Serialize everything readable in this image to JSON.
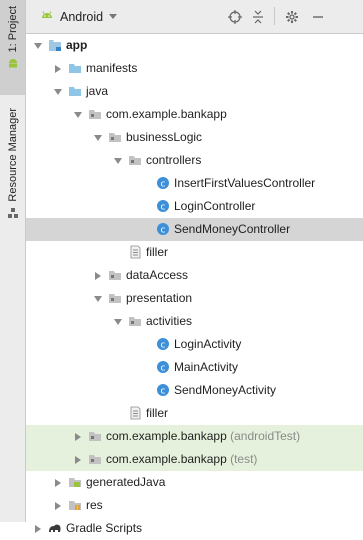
{
  "sidebar": {
    "project_tab_label": "1: Project",
    "resource_tab_label": "Resource Manager"
  },
  "toolbar": {
    "view_title": "Android"
  },
  "tree": {
    "rows": [
      {
        "label": "app",
        "suffix": "",
        "bold": true,
        "depth": 0,
        "arrow": "down",
        "icon": "module"
      },
      {
        "label": "manifests",
        "suffix": "",
        "depth": 1,
        "arrow": "right",
        "icon": "folder-blue"
      },
      {
        "label": "java",
        "suffix": "",
        "depth": 1,
        "arrow": "down",
        "icon": "folder-blue"
      },
      {
        "label": "com.example.bankapp",
        "suffix": "",
        "depth": 2,
        "arrow": "down",
        "icon": "package"
      },
      {
        "label": "businessLogic",
        "suffix": "",
        "depth": 3,
        "arrow": "down",
        "icon": "package"
      },
      {
        "label": "controllers",
        "suffix": "",
        "depth": 4,
        "arrow": "down",
        "icon": "package"
      },
      {
        "label": "InsertFirstValuesController",
        "suffix": "",
        "depth": 5,
        "arrow": "",
        "icon": "class"
      },
      {
        "label": "LoginController",
        "suffix": "",
        "depth": 5,
        "arrow": "",
        "icon": "class"
      },
      {
        "label": "SendMoneyController",
        "suffix": "",
        "depth": 5,
        "arrow": "",
        "icon": "class",
        "state": "selected"
      },
      {
        "label": "filler",
        "suffix": "",
        "depth": 4,
        "arrow": "",
        "icon": "file"
      },
      {
        "label": "dataAccess",
        "suffix": "",
        "depth": 3,
        "arrow": "right",
        "icon": "package"
      },
      {
        "label": "presentation",
        "suffix": "",
        "depth": 3,
        "arrow": "down",
        "icon": "package"
      },
      {
        "label": "activities",
        "suffix": "",
        "depth": 4,
        "arrow": "down",
        "icon": "package"
      },
      {
        "label": "LoginActivity",
        "suffix": "",
        "depth": 5,
        "arrow": "",
        "icon": "class"
      },
      {
        "label": "MainActivity",
        "suffix": "",
        "depth": 5,
        "arrow": "",
        "icon": "class"
      },
      {
        "label": "SendMoneyActivity",
        "suffix": "",
        "depth": 5,
        "arrow": "",
        "icon": "class"
      },
      {
        "label": "filler",
        "suffix": "",
        "depth": 4,
        "arrow": "",
        "icon": "file"
      },
      {
        "label": "com.example.bankapp",
        "suffix": "(androidTest)",
        "depth": 2,
        "arrow": "right",
        "icon": "package",
        "state": "test"
      },
      {
        "label": "com.example.bankapp",
        "suffix": "(test)",
        "depth": 2,
        "arrow": "right",
        "icon": "package",
        "state": "test"
      },
      {
        "label": "generatedJava",
        "suffix": "",
        "depth": 1,
        "arrow": "right",
        "icon": "folder-gen"
      },
      {
        "label": "res",
        "suffix": "",
        "depth": 1,
        "arrow": "right",
        "icon": "folder-res"
      },
      {
        "label": "Gradle Scripts",
        "suffix": "",
        "depth": 0,
        "arrow": "right",
        "icon": "gradle"
      }
    ]
  },
  "colors": {
    "selected_row": "#d5d5d5",
    "test_row": "#e5f1dc",
    "class_icon": "#3d8fd8",
    "android_green": "#9ac43c",
    "folder_blue": "#8fc5e7"
  }
}
